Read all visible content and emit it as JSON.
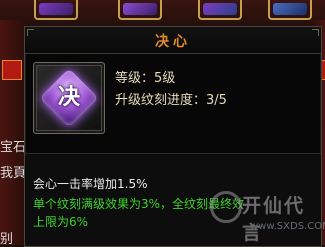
{
  "tooltip": {
    "title": "决心",
    "item_icon_glyph": "决",
    "level_label": "等级：5级",
    "progress_label": "升级纹刻进度：3/5",
    "description": "会心一击率增加1.5%",
    "bonus_line_1": "单个纹刻满级效果为3%，全纹刻最终效",
    "bonus_line_2": "上限为6%"
  },
  "background": {
    "left_text_1": "宝石",
    "left_text_2": "我頁",
    "left_text_3": "别"
  },
  "watermark": {
    "title": "开仙代言",
    "url": "www.SXDS.COM"
  },
  "colors": {
    "title": "#e38a2c",
    "stat_text": "#e6dcb8",
    "bonus_text": "#3fd12f",
    "rune": "#a35bd9"
  }
}
